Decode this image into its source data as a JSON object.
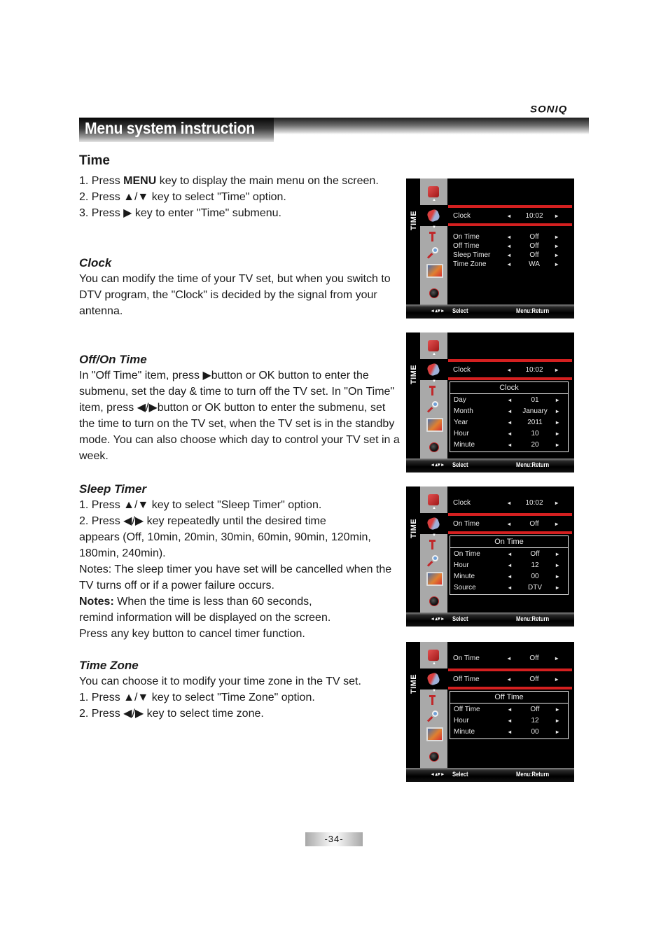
{
  "brand": "SONIQ",
  "header": {
    "title": "Menu system instruction"
  },
  "section_title": "Time",
  "intro_steps": [
    {
      "pre": "1. Press ",
      "bold": "MENU",
      "post": " key to display the main menu on the screen."
    },
    {
      "text": "2. Press ▲/▼ key to select \"Time\" option."
    },
    {
      "text": "3. Press ▶ key to enter \"Time\" submenu."
    }
  ],
  "clock": {
    "heading": "Clock",
    "body": "You can modify the time of your TV set, but when you switch to DTV program, the \"Clock\"  is decided by the signal from your antenna."
  },
  "offon": {
    "heading": "Off/On Time",
    "body": "In \"Off Time\" item, press ▶button or OK button to enter the submenu, set the day & time to turn off the TV set.  In \"On Time\" item, press ◀/▶button or OK button to enter the submenu, set the time to turn on the TV set, when the TV set is in the standby mode. You can also choose which day to control your TV set in a week."
  },
  "sleep": {
    "heading": "Sleep Timer",
    "line1": "1. Press ▲/▼ key to select \"Sleep Timer\" option.",
    "line2": "2. Press ◀/▶ key repeatedly until the desired time",
    "line3": "appears (Off, 10min, 20min, 30min, 60min, 90min, 120min,",
    "line4": "180min, 240min).",
    "note1": "Notes: The sleep timer you have set will be cancelled when the TV turns off or if a power failure occurs.",
    "note2_bold": "Notes:",
    "note2": " When the time is less than 60 seconds,",
    "note3": "remind information will be displayed on the screen.",
    "note4": "Press any key button to cancel timer function."
  },
  "timezone": {
    "heading": "Time Zone",
    "line1": "You can choose it to modify your time zone in the TV set.",
    "line2": "1. Press ▲/▼ key to select \"Time Zone\" option.",
    "line3": "2. Press ◀/▶ key to select time zone."
  },
  "osd_common": {
    "side_label": "TIME",
    "left_arrow": "◂",
    "right_arrow": "▸",
    "footer_nav": "◂ ▴▾ ▸",
    "footer_select": "Select",
    "footer_return": "Menu:Return"
  },
  "osd1": {
    "highlight": {
      "label": "Clock",
      "value": "10:02"
    },
    "rows": [
      {
        "label": "On Time",
        "value": "Off"
      },
      {
        "label": "Off Time",
        "value": "Off"
      },
      {
        "label": "Sleep Timer",
        "value": "Off"
      },
      {
        "label": "Time Zone",
        "value": "WA"
      }
    ]
  },
  "osd2": {
    "highlight": {
      "label": "Clock",
      "value": "10:02"
    },
    "sub_title": "Clock",
    "rows": [
      {
        "label": "Day",
        "value": "01"
      },
      {
        "label": "Month",
        "value": "January"
      },
      {
        "label": "Year",
        "value": "2011"
      },
      {
        "label": "Hour",
        "value": "10"
      },
      {
        "label": "Minute",
        "value": "20"
      }
    ]
  },
  "osd3": {
    "above": {
      "label": "Clock",
      "value": "10:02"
    },
    "highlight": {
      "label": "On Time",
      "value": "Off"
    },
    "sub_title": "On Time",
    "rows": [
      {
        "label": "On Time",
        "value": "Off"
      },
      {
        "label": "Hour",
        "value": "12"
      },
      {
        "label": "Minute",
        "value": "00"
      },
      {
        "label": "Source",
        "value": "DTV"
      }
    ]
  },
  "osd4": {
    "above": {
      "label": "On Time",
      "value": "Off"
    },
    "highlight": {
      "label": "Off Time",
      "value": "Off"
    },
    "sub_title": "Off Time",
    "rows": [
      {
        "label": "Off Time",
        "value": "Off"
      },
      {
        "label": "Hour",
        "value": "12"
      },
      {
        "label": "Minute",
        "value": "00"
      }
    ]
  },
  "page_number": "-34-"
}
